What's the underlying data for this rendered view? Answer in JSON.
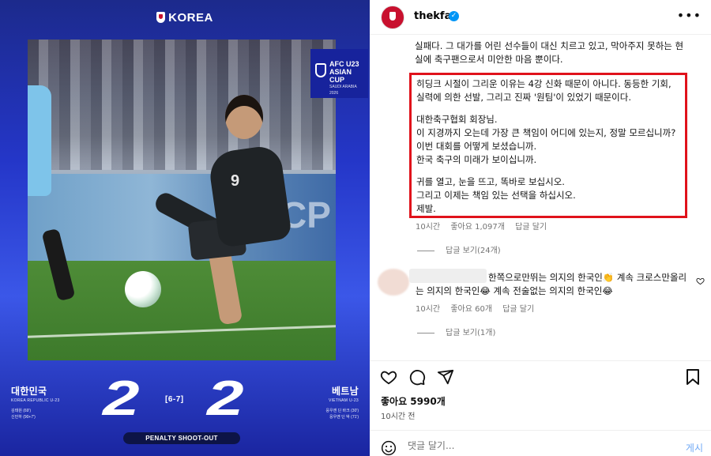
{
  "image": {
    "brand": "KOREA",
    "tournament_badge": {
      "line1": "AFC U23",
      "line2": "ASIAN CUP",
      "line3": "SAUDI ARABIA 2026"
    },
    "board_text": "CP",
    "jersey_number": "9",
    "home": {
      "name": "대한민국",
      "sub": "KOREA REPUBLIC U-23",
      "score": "2",
      "scorers": [
        "김태원 (69')",
        "신민하 (90+7')"
      ]
    },
    "away": {
      "name": "베트남",
      "sub": "VIETNAM U-23",
      "score": "2",
      "scorers": [
        "응우옌 딘 바크 (30')",
        "응우옌 딘 박 (71')"
      ]
    },
    "penalty_score": "[6-7]",
    "shootout_label": "PENALTY SHOOT-OUT"
  },
  "post": {
    "username": "thekfa",
    "caption_top": "실패다. 그 대가를 어린 선수들이 대신 치르고 있고, 막아주지 못하는 현실에 축구팬으로서 미안한 마음 뿐이다.",
    "highlight_paragraphs": [
      "히딩크 시절이 그리운 이유는 4강 신화 때문이 아니다. 동등한 기회, 실력에 의한 선발, 그리고 진짜 '원팀'이 있었기 때문이다.",
      "대한축구협회 회장님.\n이 지경까지 오는데 가장 큰 책임이 어디에 있는지, 정말 모르십니까?\n이번 대회를 어떻게 보셨습니까.\n한국 축구의 미래가 보이십니까.",
      "귀를 열고, 눈을 뜨고, 똑바로 보십시오.\n그리고 이제는 책임 있는 선택을 하십시오.\n제발."
    ],
    "comment1_meta": {
      "time": "10시간",
      "likes": "좋아요 1,097개",
      "reply": "답글 달기"
    },
    "comment1_replies": "답글 보기(24개)",
    "comment2_text": "한쪽으로만뛰는 의지의 한국인👏 계속 크로스만올리는 의지의 한국인😂 계속 전술없는 의지의 한국인😂",
    "comment2_meta": {
      "time": "10시간",
      "likes": "좋아요 60개",
      "reply": "답글 달기"
    },
    "comment2_replies": "답글 보기(1개)",
    "total_likes": "좋아요 5990개",
    "posted": "10시간 전",
    "comment_placeholder": "댓글 달기...",
    "post_label": "게시"
  },
  "colors": {
    "highlight_border": "#e0121b",
    "verified": "#0095f6",
    "link": "#6fa8f5"
  }
}
